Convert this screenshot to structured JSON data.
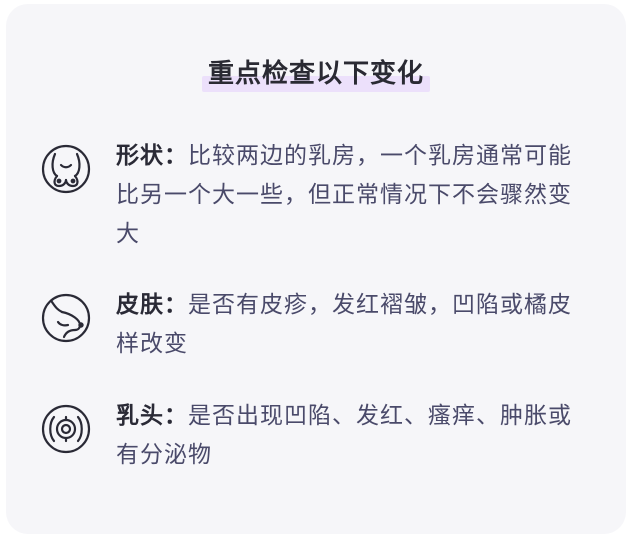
{
  "title": "重点检查以下变化",
  "items": [
    {
      "icon": "breasts-icon",
      "label": "形状：",
      "text": "比较两边的乳房，一个乳房通常可能比另一个大一些，但正常情况下不会骤然变大"
    },
    {
      "icon": "breast-side-icon",
      "label": "皮肤：",
      "text": "是否有皮疹，发红褶皱，凹陷或橘皮样改变"
    },
    {
      "icon": "nipple-icon",
      "label": "乳头：",
      "text": "是否出现凹陷、发红、瘙痒、肿胀或有分泌物"
    }
  ],
  "colors": {
    "card_bg": "#f6f6f9",
    "title_highlight": "#ece0fb",
    "icon_stroke": "#2a2a36",
    "body_text": "#4a4a6a"
  }
}
